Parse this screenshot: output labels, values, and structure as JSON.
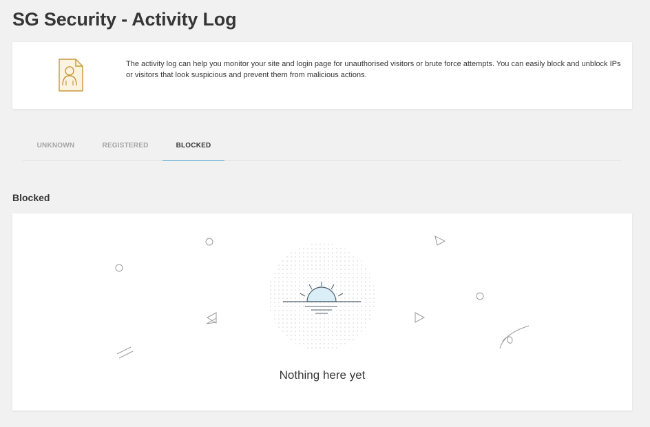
{
  "header": {
    "title": "SG Security - Activity Log"
  },
  "intro": {
    "icon": "user-document-icon",
    "text": "The activity log can help you monitor your site and login page for unauthorised visitors or brute force attempts. You can easily block and unblock IPs or visitors that look suspicious and prevent them from malicious actions."
  },
  "tabs": [
    {
      "label": "UNKNOWN",
      "active": false
    },
    {
      "label": "REGISTERED",
      "active": false
    },
    {
      "label": "BLOCKED",
      "active": true
    }
  ],
  "section": {
    "title": "Blocked"
  },
  "empty_state": {
    "illustration": "sunrise-icon",
    "message": "Nothing here yet"
  },
  "colors": {
    "accent": "#3e9dcc",
    "icon_gold": "#c49a3c",
    "icon_fill": "#fbf3df",
    "page_bg": "#f1f1f1"
  }
}
